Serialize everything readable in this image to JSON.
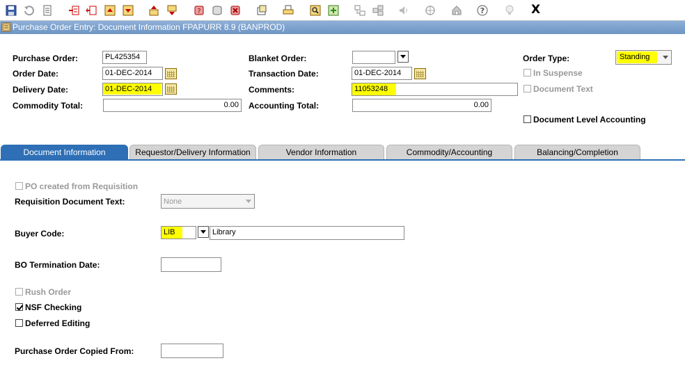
{
  "toolbar": {
    "icons": [
      "save-icon",
      "rollback-icon",
      "print-icon",
      "insert-record-icon",
      "remove-record-icon",
      "previous-block-icon",
      "next-block-icon",
      "previous-record-icon",
      "next-record-icon",
      "query-icon",
      "execute-query-icon",
      "cancel-query-icon",
      "options-icon",
      "print-preview-icon",
      "search-icon",
      "insert-icon",
      "link-icon",
      "unlink-icon",
      "speaker-icon",
      "target-icon",
      "home-icon",
      "help-icon",
      "lightbulb-icon"
    ],
    "exit_label": "X"
  },
  "window": {
    "title": "Purchase Order Entry: Document Information  FPAPURR  8.9  (BANPROD)"
  },
  "header": {
    "purchase_order_label": "Purchase Order:",
    "purchase_order_value": "PL425354",
    "order_date_label": "Order Date:",
    "order_date_value": "01-DEC-2014",
    "delivery_date_label": "Delivery Date:",
    "delivery_date_value": "01-DEC-2014",
    "commodity_total_label": "Commodity Total:",
    "commodity_total_value": "0.00",
    "blanket_order_label": "Blanket Order:",
    "blanket_order_value": "",
    "transaction_date_label": "Transaction Date:",
    "transaction_date_value": "01-DEC-2014",
    "comments_label": "Comments:",
    "comments_value": "11053248",
    "accounting_total_label": "Accounting Total:",
    "accounting_total_value": "0.00",
    "order_type_label": "Order Type:",
    "order_type_value": "Standing",
    "in_suspense_label": "In Suspense",
    "document_text_label": "Document Text",
    "document_level_accounting_label": "Document Level Accounting"
  },
  "tabs": [
    {
      "label": "Document Information",
      "active": true
    },
    {
      "label": "Requestor/Delivery Information",
      "active": false
    },
    {
      "label": "Vendor Information",
      "active": false
    },
    {
      "label": "Commodity/Accounting",
      "active": false
    },
    {
      "label": "Balancing/Completion",
      "active": false
    }
  ],
  "main": {
    "po_from_requisition_label": "PO created from Requisition",
    "requisition_doc_text_label": "Requisition Document Text:",
    "requisition_doc_text_value": "None",
    "buyer_code_label": "Buyer Code:",
    "buyer_code_value": "LIB",
    "buyer_name_value": "Library",
    "bo_termination_date_label": "BO Termination Date:",
    "bo_termination_date_value": "",
    "rush_order_label": "Rush Order",
    "nsf_checking_label": "NSF Checking",
    "nsf_checking_checked": true,
    "deferred_editing_label": "Deferred Editing",
    "po_copied_from_label": "Purchase Order Copied From:",
    "po_copied_from_value": ""
  },
  "colors": {
    "highlight": "#ffff00",
    "active_tab": "#2e6fb5",
    "title_bar": "#7a9fcc"
  }
}
